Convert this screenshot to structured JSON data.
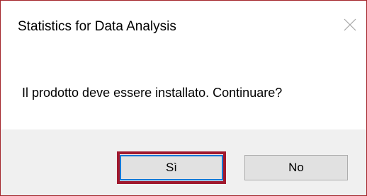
{
  "dialog": {
    "title": "Statistics for Data Analysis",
    "close_icon": "close-icon",
    "message": "Il prodotto deve essere installato. Continuare?",
    "buttons": {
      "yes_label": "Sì",
      "no_label": "No"
    }
  },
  "colors": {
    "window_border": "#a4262c",
    "highlight": "#a0192e",
    "footer_bg": "#f0f0f0",
    "button_bg": "#e1e1e1",
    "button_focus_border": "#0078d7"
  }
}
